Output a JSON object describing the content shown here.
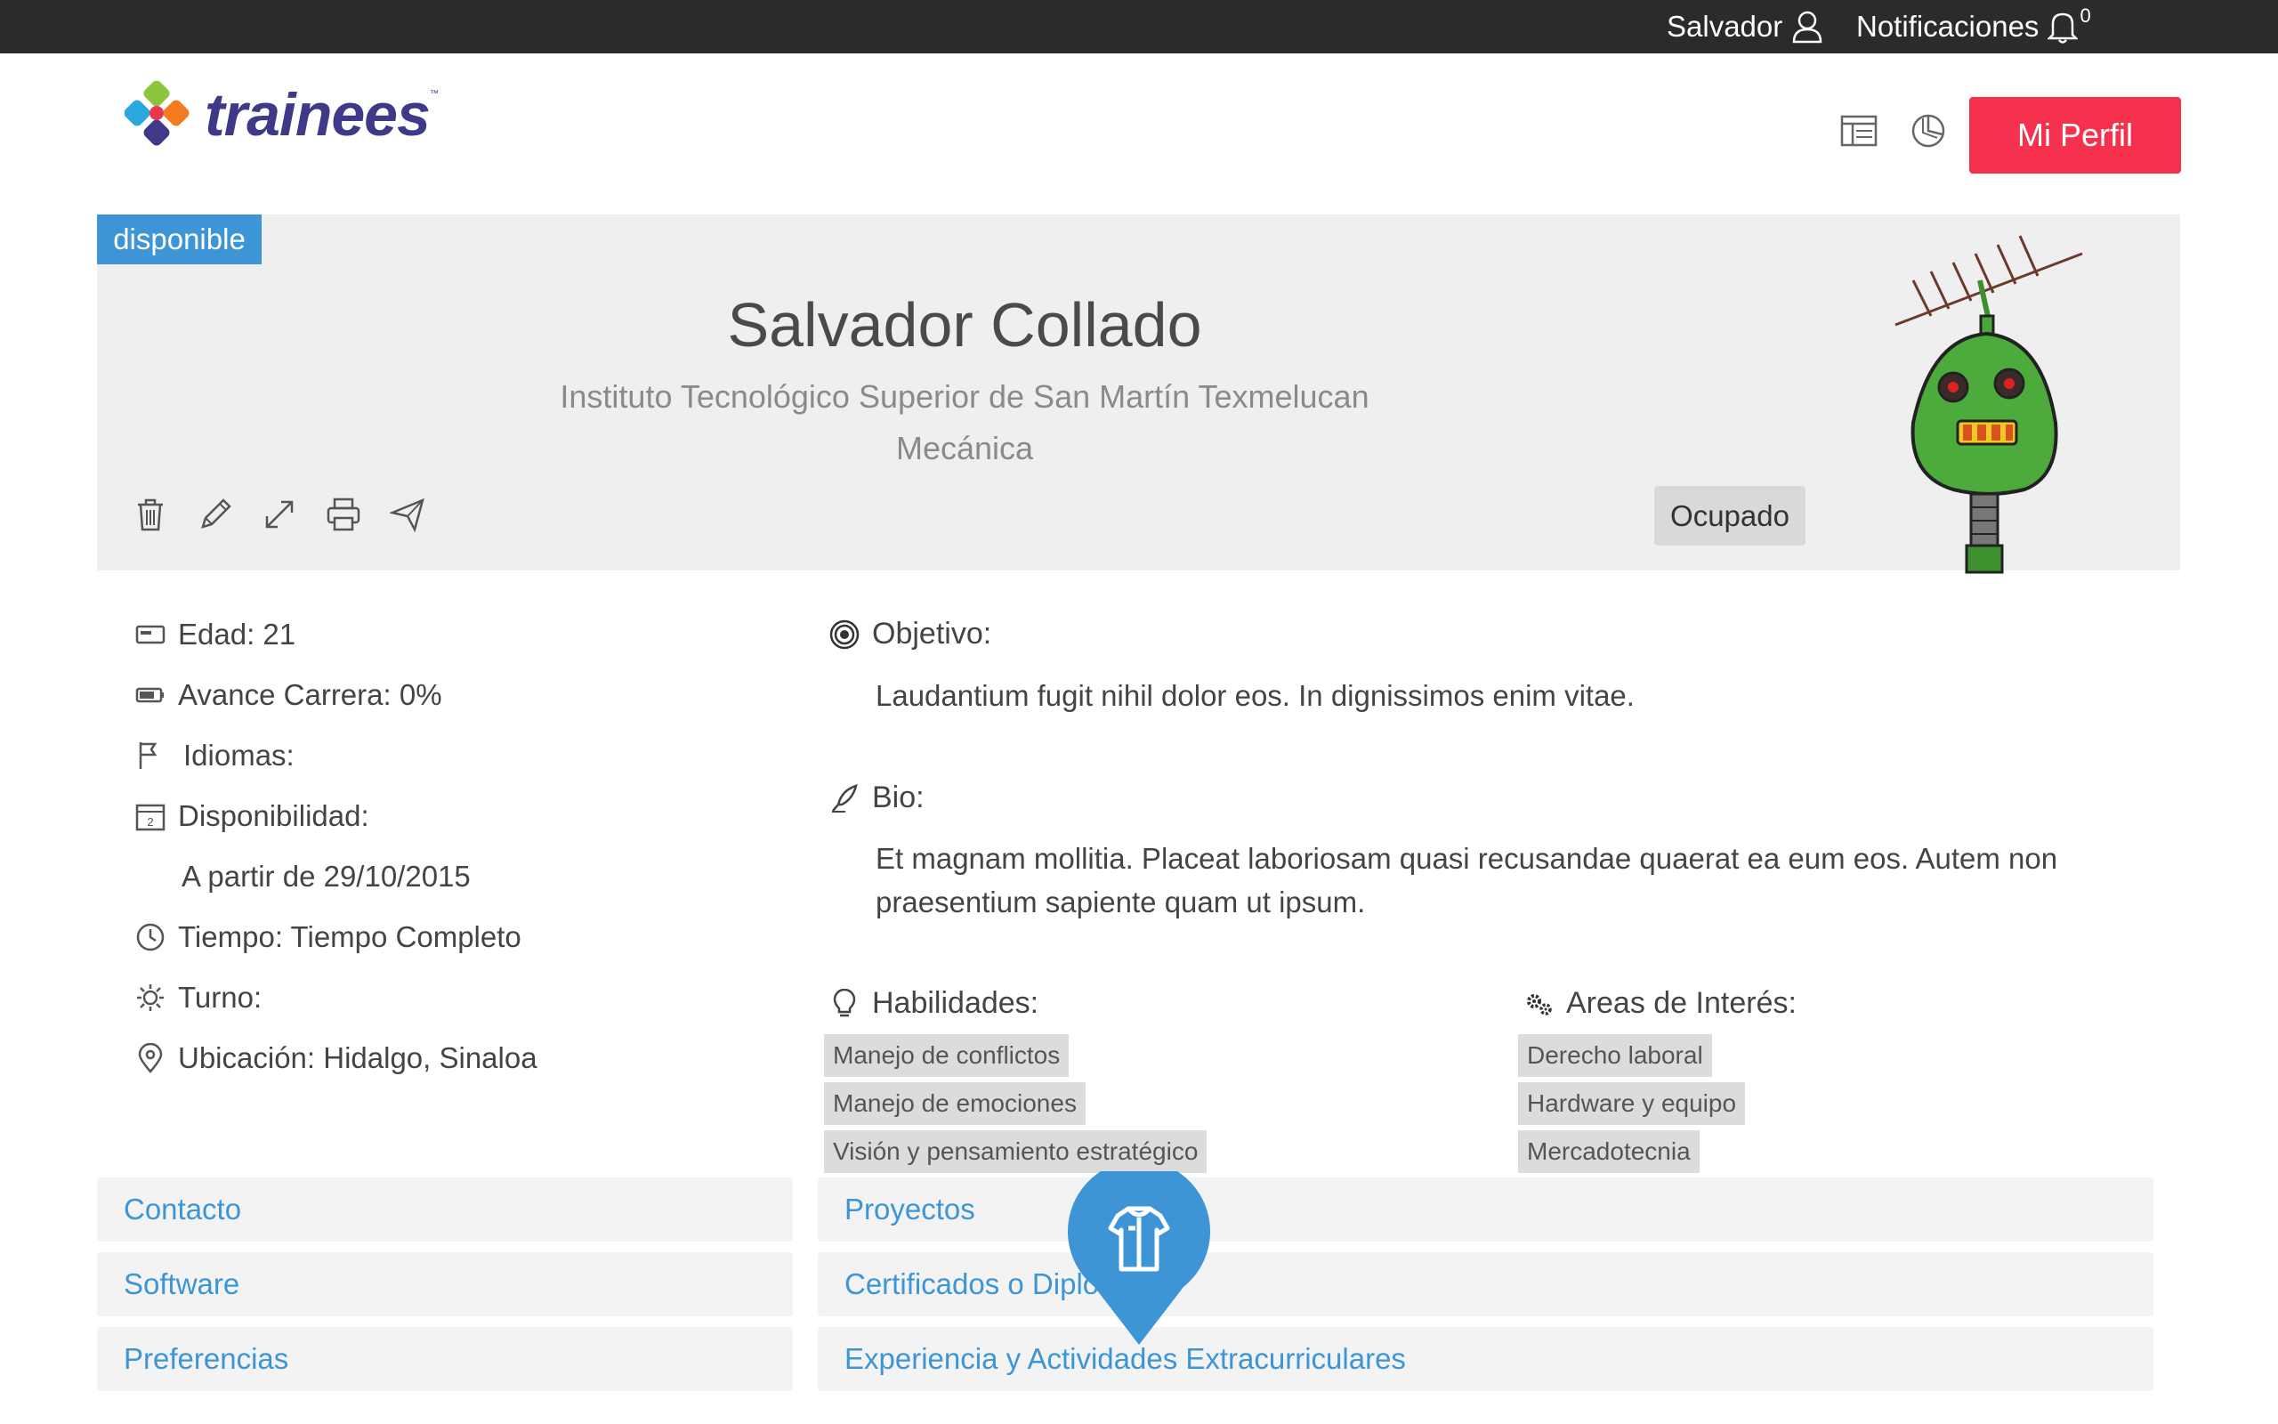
{
  "topbar": {
    "user_name": "Salvador",
    "notifications_label": "Notificaciones",
    "notifications_count": "0"
  },
  "header": {
    "logo_text": "trainees",
    "logo_tm": "™",
    "profile_button": "Mi Perfil"
  },
  "profile": {
    "status_tag": "disponible",
    "name": "Salvador Collado",
    "school": "Instituto Tecnológico Superior de San Martín Texmelucan",
    "career": "Mecánica",
    "busy_button": "Ocupado"
  },
  "info": {
    "age": "Edad: 21",
    "career_progress": "Avance Carrera: 0%",
    "languages": "Idiomas:",
    "availability": "Disponibilidad:",
    "availability_date": "A partir de 29/10/2015",
    "time": "Tiempo: Tiempo Completo",
    "shift": "Turno:",
    "location": "Ubicación: Hidalgo, Sinaloa"
  },
  "objective": {
    "title": "Objetivo:",
    "text": "Laudantium fugit nihil dolor eos. In dignissimos enim vitae."
  },
  "bio": {
    "title": "Bio:",
    "line1": "Et magnam mollitia. Placeat laboriosam quasi recusandae quaerat ea eum eos. Autem non",
    "line2": "praesentium sapiente quam ut ipsum."
  },
  "skills": {
    "title": "Habilidades:",
    "items": [
      "Manejo de conflictos",
      "Manejo de emociones",
      "Visión y pensamiento estratégico"
    ]
  },
  "interests": {
    "title": "Areas de Interés:",
    "items": [
      "Derecho laboral",
      "Hardware y equipo",
      "Mercadotecnia"
    ]
  },
  "accordion": {
    "left": [
      "Contacto",
      "Software",
      "Preferencias"
    ],
    "right": [
      "Proyectos",
      "Certificados o Diplomas",
      "Experiencia y Actividades Extracurriculares"
    ]
  },
  "colors": {
    "accent": "#3d95d6",
    "brand": "#3f3a88",
    "primary_button": "#f6314e",
    "topbar": "#2b2b2b"
  },
  "icons": [
    "user-icon",
    "bell-icon",
    "layout-icon",
    "chart-icon",
    "trash-icon",
    "pencil-icon",
    "expand-icon",
    "print-icon",
    "send-icon",
    "id-card-icon",
    "battery-icon",
    "flag-icon",
    "calendar-icon",
    "clock-icon",
    "sun-icon",
    "location-pin-icon",
    "target-icon",
    "quill-icon",
    "lightbulb-icon",
    "gears-icon",
    "shirt-icon"
  ]
}
